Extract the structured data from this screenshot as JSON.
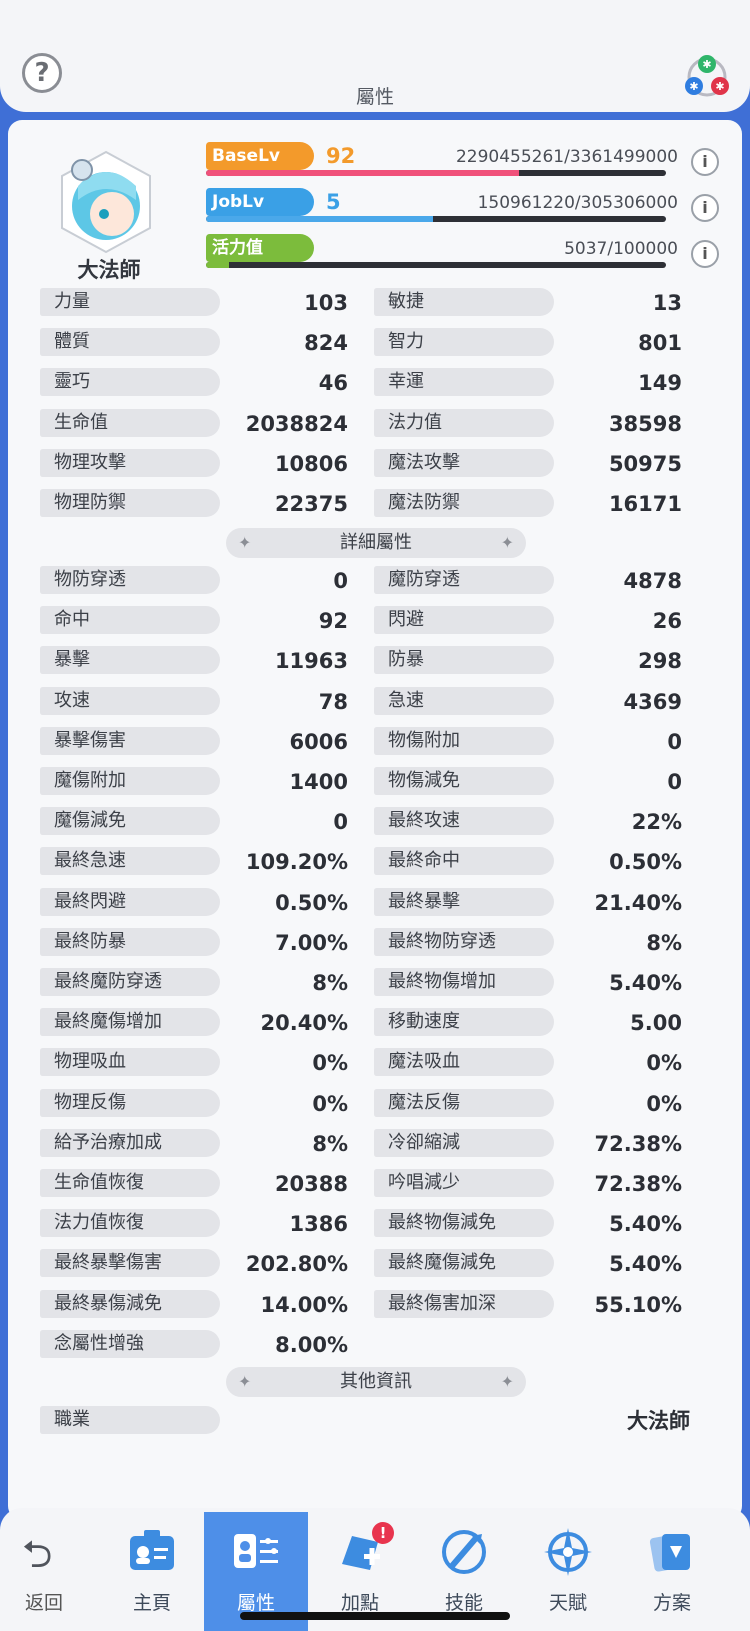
{
  "header": {
    "title": "屬性",
    "help_icon": "?"
  },
  "character": {
    "job": "大法師"
  },
  "levels": [
    {
      "tag": "BaseLv",
      "value": "92",
      "exp": "2290455261/3361499000",
      "progress": 0.681,
      "tag_color": "#f39a2b",
      "fill_color": "#f0517a",
      "num_color": "#f39a2b"
    },
    {
      "tag": "JobLv",
      "value": "5",
      "exp": "150961220/305306000",
      "progress": 0.494,
      "tag_color": "#3aa0e6",
      "fill_color": "#4aa8ea",
      "num_color": "#3aa0e6"
    },
    {
      "tag": "活力值",
      "value": "",
      "exp": "5037/100000",
      "progress": 0.05,
      "tag_color": "#7cbc3c",
      "fill_color": "#7cbc3c",
      "num_color": "#7cbc3c"
    }
  ],
  "info_icon": "i",
  "base_stats": [
    {
      "label": "力量",
      "value": "103"
    },
    {
      "label": "敏捷",
      "value": "13"
    },
    {
      "label": "體質",
      "value": "824"
    },
    {
      "label": "智力",
      "value": "801"
    },
    {
      "label": "靈巧",
      "value": "46"
    },
    {
      "label": "幸運",
      "value": "149"
    },
    {
      "label": "生命值",
      "value": "2038824"
    },
    {
      "label": "法力值",
      "value": "38598"
    },
    {
      "label": "物理攻擊",
      "value": "10806"
    },
    {
      "label": "魔法攻擊",
      "value": "50975"
    },
    {
      "label": "物理防禦",
      "value": "22375"
    },
    {
      "label": "魔法防禦",
      "value": "16171"
    }
  ],
  "section_detail": "詳細屬性",
  "detail_stats": [
    {
      "label": "物防穿透",
      "value": "0"
    },
    {
      "label": "魔防穿透",
      "value": "4878"
    },
    {
      "label": "命中",
      "value": "92"
    },
    {
      "label": "閃避",
      "value": "26"
    },
    {
      "label": "暴擊",
      "value": "11963"
    },
    {
      "label": "防暴",
      "value": "298"
    },
    {
      "label": "攻速",
      "value": "78"
    },
    {
      "label": "急速",
      "value": "4369"
    },
    {
      "label": "暴擊傷害",
      "value": "6006"
    },
    {
      "label": "物傷附加",
      "value": "0"
    },
    {
      "label": "魔傷附加",
      "value": "1400"
    },
    {
      "label": "物傷減免",
      "value": "0"
    },
    {
      "label": "魔傷減免",
      "value": "0"
    },
    {
      "label": "最終攻速",
      "value": "22%"
    },
    {
      "label": "最終急速",
      "value": "109.20%"
    },
    {
      "label": "最終命中",
      "value": "0.50%"
    },
    {
      "label": "最終閃避",
      "value": "0.50%"
    },
    {
      "label": "最終暴擊",
      "value": "21.40%"
    },
    {
      "label": "最終防暴",
      "value": "7.00%"
    },
    {
      "label": "最終物防穿透",
      "value": "8%"
    },
    {
      "label": "最終魔防穿透",
      "value": "8%"
    },
    {
      "label": "最終物傷增加",
      "value": "5.40%"
    },
    {
      "label": "最終魔傷增加",
      "value": "20.40%"
    },
    {
      "label": "移動速度",
      "value": "5.00"
    },
    {
      "label": "物理吸血",
      "value": "0%"
    },
    {
      "label": "魔法吸血",
      "value": "0%"
    },
    {
      "label": "物理反傷",
      "value": "0%"
    },
    {
      "label": "魔法反傷",
      "value": "0%"
    },
    {
      "label": "給予治療加成",
      "value": "8%"
    },
    {
      "label": "冷卻縮減",
      "value": "72.38%"
    },
    {
      "label": "生命值恢復",
      "value": "20388"
    },
    {
      "label": "吟唱減少",
      "value": "72.38%"
    },
    {
      "label": "法力值恢復",
      "value": "1386"
    },
    {
      "label": "最終物傷減免",
      "value": "5.40%"
    },
    {
      "label": "最終暴擊傷害",
      "value": "202.80%"
    },
    {
      "label": "最終魔傷減免",
      "value": "5.40%"
    },
    {
      "label": "最終暴傷減免",
      "value": "14.00%"
    },
    {
      "label": "最終傷害加深",
      "value": "55.10%"
    },
    {
      "label": "念屬性增強",
      "value": "8.00%"
    }
  ],
  "section_other": "其他資訊",
  "other_stats": [
    {
      "label": "職業",
      "value": "大法師"
    }
  ],
  "tabs": {
    "back": "返回",
    "items": [
      {
        "label": "主頁",
        "icon": "profile-card-icon",
        "active": false
      },
      {
        "label": "屬性",
        "icon": "stats-icon",
        "active": true
      },
      {
        "label": "加點",
        "icon": "add-point-icon",
        "active": false,
        "badge": "!"
      },
      {
        "label": "技能",
        "icon": "skill-icon",
        "active": false
      },
      {
        "label": "天賦",
        "icon": "talent-icon",
        "active": false
      },
      {
        "label": "方案",
        "icon": "plan-icon",
        "active": false
      }
    ]
  }
}
